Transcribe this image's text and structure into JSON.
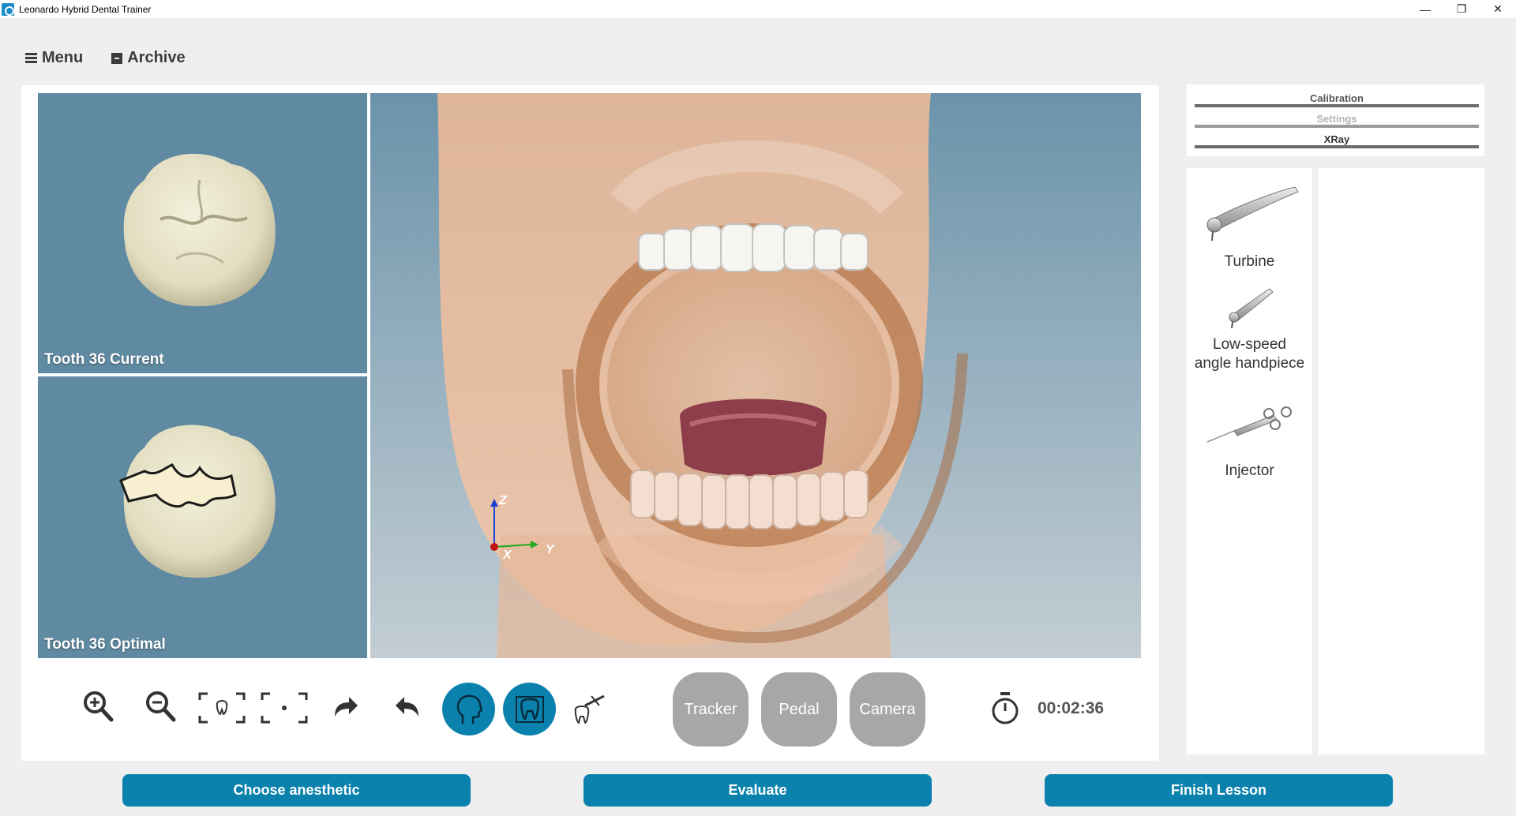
{
  "window": {
    "title": "Leonardo Hybrid Dental Trainer",
    "controls": {
      "minimize": "—",
      "restore": "❐",
      "close": "✕"
    }
  },
  "menu": {
    "menu_label": "Menu",
    "archive_label": "Archive"
  },
  "tooth_views": {
    "current_label": "Tooth 36 Current",
    "optimal_label": "Tooth 36 Optimal"
  },
  "axes": {
    "z": "Z",
    "x": "X",
    "y": "Y"
  },
  "controls": {
    "icons": [
      "zoom-in-icon",
      "zoom-out-icon",
      "frame-tooth-icon",
      "frame-center-icon",
      "redo-icon",
      "undo-icon",
      "head-view-icon",
      "tooth-view-icon",
      "tooth-drill-icon"
    ],
    "tracker_label": "Tracker",
    "pedal_label": "Pedal",
    "camera_label": "Camera",
    "timer": "00:02:36"
  },
  "buttons": {
    "choose_anesthetic": "Choose anesthetic",
    "evaluate": "Evaluate",
    "finish_lesson": "Finish Lesson"
  },
  "modes": {
    "calibration": "Calibration",
    "settings": "Settings",
    "xray": "XRay"
  },
  "tools": {
    "turbine": "Turbine",
    "low_speed_line1": "Low-speed",
    "low_speed_line2": "angle handpiece",
    "injector": "Injector"
  },
  "colors": {
    "accent": "#0a82ad",
    "pill_gray": "#a7a7a7",
    "tooth_bg": "#5f8aa1",
    "disabled_text": "#b5b5b5"
  }
}
